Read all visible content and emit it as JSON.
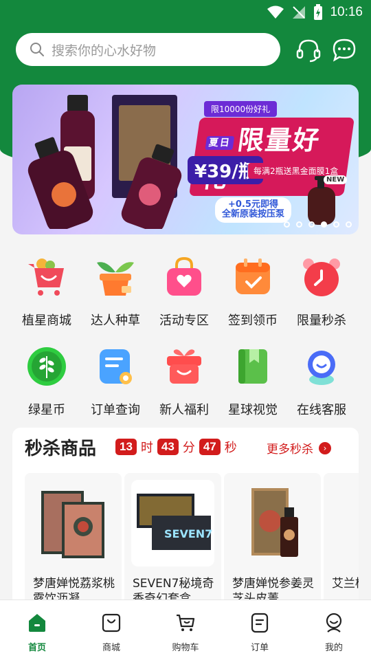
{
  "status": {
    "time": "10:16"
  },
  "search": {
    "placeholder": "搜索你的心水好物"
  },
  "banner": {
    "top_tag": "限10000份好礼",
    "title": "限量好礼",
    "season_tag": "夏日",
    "price": "¥39/瓶",
    "sub": "每满2瓶送黑金面膜1盒",
    "badge_line1": "+0.5元即得",
    "badge_line2": "全新原装按压泵",
    "new_tag": "NEW"
  },
  "categories": [
    {
      "label": "植星商城",
      "icon": "shopping-cart-icon"
    },
    {
      "label": "达人种草",
      "icon": "plant-pot-icon"
    },
    {
      "label": "活动专区",
      "icon": "shopping-bag-icon"
    },
    {
      "label": "签到领币",
      "icon": "calendar-check-icon"
    },
    {
      "label": "限量秒杀",
      "icon": "alarm-clock-icon"
    },
    {
      "label": "绿星币",
      "icon": "leaf-coin-icon"
    },
    {
      "label": "订单查询",
      "icon": "order-note-icon"
    },
    {
      "label": "新人福利",
      "icon": "gift-box-icon"
    },
    {
      "label": "星球视觉",
      "icon": "book-icon"
    },
    {
      "label": "在线客服",
      "icon": "customer-service-icon"
    }
  ],
  "flash_sale": {
    "title": "秒杀商品",
    "hours": "13",
    "hours_unit": "时",
    "minutes": "43",
    "minutes_unit": "分",
    "seconds": "47",
    "seconds_unit": "秒",
    "more": "更多秒杀",
    "products": [
      {
        "name": "梦唐婵悦荔浆桃露饮沥凝"
      },
      {
        "name": "SEVEN7秘境奇香奇幻套盒"
      },
      {
        "name": "梦唐婵悦参姜灵芝头皮菁"
      },
      {
        "name": "艾兰桃"
      }
    ]
  },
  "tabbar": [
    {
      "label": "首页",
      "active": true
    },
    {
      "label": "商城"
    },
    {
      "label": "购物车"
    },
    {
      "label": "订单"
    },
    {
      "label": "我的"
    }
  ],
  "colors": {
    "brand_green": "#13883d",
    "flash_red": "#d21c1c"
  }
}
